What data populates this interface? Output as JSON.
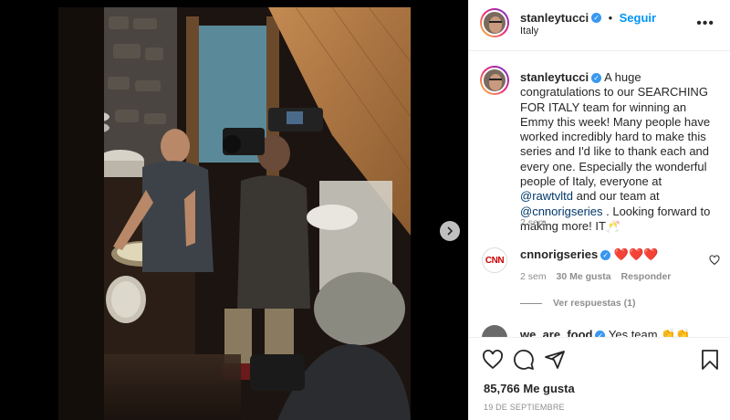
{
  "post": {
    "username": "stanleytucci",
    "follow_label": "Seguir",
    "location": "Italy",
    "more_label": "•••"
  },
  "caption": {
    "username": "stanleytucci",
    "text_part1": "A huge congratulations to our SEARCHING FOR ITALY team for winning an Emmy this week! Many people have worked incredibly hard to make this series and I'd like to thank each and every one. Especially the wonderful people of Italy, everyone at ",
    "mention1": "@rawtvltd",
    "text_part2": " and our team at ",
    "mention2": "@cnnorigseries",
    "text_part3": " . Looking forward to making more! IT🥂",
    "time": "2 sem"
  },
  "comment1": {
    "avatar_text": "CNN",
    "username": "cnnorigseries",
    "text": "❤️❤️❤️",
    "time": "2 sem",
    "likes": "30 Me gusta",
    "reply_label": "Responder",
    "view_replies": "Ver respuestas (1)"
  },
  "comment2": {
    "username": "we_are_food",
    "text": "Yes team 👏👏"
  },
  "footer": {
    "likes": "85,766 Me gusta",
    "date": "19 DE SEPTIEMBRE"
  },
  "icons": {
    "like": "heart-icon",
    "comment": "comment-icon",
    "share": "share-icon",
    "save": "bookmark-icon",
    "next": "chevron-right-icon"
  },
  "colors": {
    "accent": "#0095f6",
    "verified": "#3897f0",
    "heart": "#ed4956",
    "cnn": "#cc0000"
  }
}
